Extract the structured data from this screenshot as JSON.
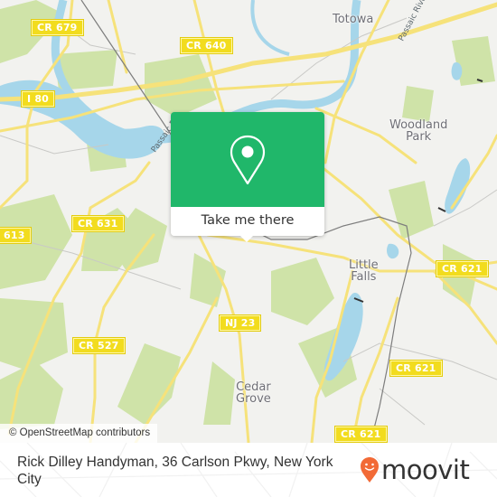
{
  "map": {
    "colors": {
      "land": "#f2f2ef",
      "park": "#cfe3a8",
      "water": "#a6d6ea",
      "road_major": "#f6e27a",
      "road_minor": "#c9c9c6",
      "railway": "#7d7d7d",
      "popup_green": "#20b76a",
      "moovit_orange": "#f26a36"
    },
    "road_labels": [
      {
        "id": "cr679",
        "text": "CR 679"
      },
      {
        "id": "cr640",
        "text": "CR 640"
      },
      {
        "id": "i80",
        "text": "I 80"
      },
      {
        "id": "cr631",
        "text": "CR 631"
      },
      {
        "id": "cr613",
        "text": "613"
      },
      {
        "id": "cr527",
        "text": "CR 527"
      },
      {
        "id": "nj23",
        "text": "NJ 23"
      },
      {
        "id": "cr621a",
        "text": "CR 621"
      },
      {
        "id": "cr621b",
        "text": "CR 621"
      },
      {
        "id": "cr621c",
        "text": "CR 621"
      }
    ],
    "place_labels": [
      {
        "id": "totowa",
        "text": "Totowa"
      },
      {
        "id": "woodland-park",
        "text": "Woodland\nPark"
      },
      {
        "id": "little-falls",
        "text": "Little\nFalls"
      },
      {
        "id": "cedar-grove",
        "text": "Cedar\nGrove"
      }
    ],
    "river_labels": [
      {
        "id": "passaic-1",
        "text": "Passaic River"
      },
      {
        "id": "passaic-2",
        "text": "Passaic R"
      }
    ],
    "attribution": "© OpenStreetMap contributors"
  },
  "popup": {
    "icon": "map-pin-icon",
    "button_label": "Take me there"
  },
  "footer": {
    "title": "Rick Dilley Handyman, 36 Carlson Pkwy, New York City",
    "logo_text": "moovit",
    "logo_icon": "moovit-smiley-pin-icon"
  }
}
